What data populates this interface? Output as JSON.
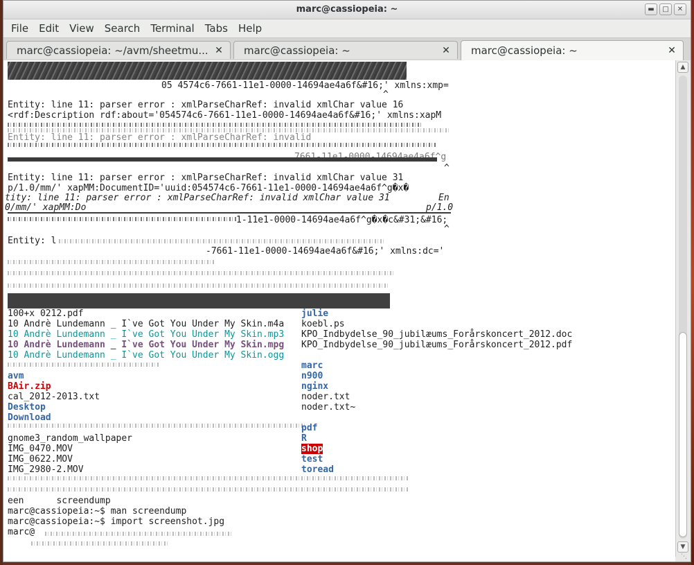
{
  "window": {
    "title": "marc@cassiopeia: ~"
  },
  "menu": [
    "File",
    "Edit",
    "View",
    "Search",
    "Terminal",
    "Tabs",
    "Help"
  ],
  "tabs": [
    {
      "label": "marc@cassiopeia: ~/avm/sheetmu..."
    },
    {
      "label": "marc@cassiopeia: ~"
    },
    {
      "label": "marc@cassiopeia: ~"
    }
  ],
  "terminal": {
    "lines": [
      "05 4574c6-7661-11e1-0000-14694ae4a6f&#16;' xmlns:xmp=",
      "^",
      "Entity: line 11: parser error : xmlParseCharRef: invalid xmlChar value 16",
      "<rdf:Description rdf:about='054574c6-7661-11e1-0000-14694ae4a6f&#16;' xmlns:xapM",
      "Entity: line 11: parser error : xmlParseCharRef: invalid",
      "7661-11e1-0000-14694ae4a6f^g",
      "^",
      "Entity: line 11: parser error : xmlParseCharRef: invalid xmlChar value 31",
      "p/1.0/mm/' xapMM:DocumentID='uuid:054574c6-7661-11e1-0000-14694ae4a6f^g�x�",
      "tity: line 11: parser error : xmlParseCharRef: invalid xmlChar value 31",
      "En",
      "0/mm/' xapMM:Do",
      "p/1.0",
      "1-11e1-0000-14694ae4a6f^g�x�c&#31;&#16;",
      "^",
      "Entity: l",
      "-7661-11e1-0000-14694ae4a6f&#16;' xmlns:dc='"
    ],
    "files_left": [
      "100+x 0212.pdf",
      "10 Andrè Lundemann _ I`ve Got You Under My Skin.m4a",
      "10 Andrè Lundemann _ I`ve Got You Under My Skin.mp3",
      "10 Andrè Lundemann _ I`ve Got You Under My Skin.mpg",
      "10 Andrè Lundemann _ I`ve Got You Under My Skin.ogg",
      "avm",
      "BAir.zip",
      "cal_2012-2013.txt",
      "Desktop",
      "Download",
      "gnome3_random_wallpaper",
      "IMG_0470.MOV",
      "IMG_0622.MOV",
      "IMG_2980-2.MOV"
    ],
    "files_right": [
      "julie",
      "koebl.ps",
      "KPO_Indbydelse_90_jubilæums_Forårskoncert_2012.doc",
      "KPO_Indbydelse_90_jubilæums_Forårskoncert_2012.pdf",
      "marc",
      "n900",
      "nginx",
      "noder.txt",
      "noder.txt~",
      "pdf",
      "R",
      "shop",
      "test",
      "toread"
    ],
    "tail": [
      "een      screendump",
      "marc@cassiopeia:~$ man screendump",
      "marc@cassiopeia:~$ import screenshot.jpg",
      "marc@"
    ]
  },
  "icons": {
    "minimize": "minimize-icon",
    "maximize": "maximize-icon",
    "close": "close-icon"
  }
}
